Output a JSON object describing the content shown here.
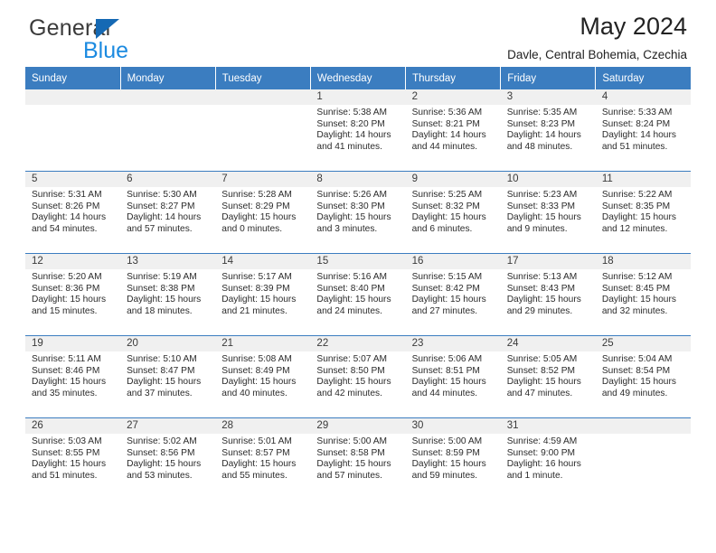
{
  "brand": {
    "word1": "General",
    "word2": "Blue",
    "triangle_color": "#1569b4",
    "blue_color": "#1b8ae0"
  },
  "header": {
    "title": "May 2024",
    "subtitle": "Davle, Central Bohemia, Czechia",
    "header_bg": "#3b7dc0"
  },
  "weekday_headers": [
    "Sunday",
    "Monday",
    "Tuesday",
    "Wednesday",
    "Thursday",
    "Friday",
    "Saturday"
  ],
  "labels": {
    "sunrise": "Sunrise:",
    "sunset": "Sunset:",
    "daylight": "Daylight:"
  },
  "weeks": [
    [
      {
        "day": "",
        "sunrise": "",
        "sunset": "",
        "daylight_line1": "",
        "daylight_line2": ""
      },
      {
        "day": "",
        "sunrise": "",
        "sunset": "",
        "daylight_line1": "",
        "daylight_line2": ""
      },
      {
        "day": "",
        "sunrise": "",
        "sunset": "",
        "daylight_line1": "",
        "daylight_line2": ""
      },
      {
        "day": "1",
        "sunrise": "Sunrise: 5:38 AM",
        "sunset": "Sunset: 8:20 PM",
        "daylight_line1": "Daylight: 14 hours",
        "daylight_line2": "and 41 minutes."
      },
      {
        "day": "2",
        "sunrise": "Sunrise: 5:36 AM",
        "sunset": "Sunset: 8:21 PM",
        "daylight_line1": "Daylight: 14 hours",
        "daylight_line2": "and 44 minutes."
      },
      {
        "day": "3",
        "sunrise": "Sunrise: 5:35 AM",
        "sunset": "Sunset: 8:23 PM",
        "daylight_line1": "Daylight: 14 hours",
        "daylight_line2": "and 48 minutes."
      },
      {
        "day": "4",
        "sunrise": "Sunrise: 5:33 AM",
        "sunset": "Sunset: 8:24 PM",
        "daylight_line1": "Daylight: 14 hours",
        "daylight_line2": "and 51 minutes."
      }
    ],
    [
      {
        "day": "5",
        "sunrise": "Sunrise: 5:31 AM",
        "sunset": "Sunset: 8:26 PM",
        "daylight_line1": "Daylight: 14 hours",
        "daylight_line2": "and 54 minutes."
      },
      {
        "day": "6",
        "sunrise": "Sunrise: 5:30 AM",
        "sunset": "Sunset: 8:27 PM",
        "daylight_line1": "Daylight: 14 hours",
        "daylight_line2": "and 57 minutes."
      },
      {
        "day": "7",
        "sunrise": "Sunrise: 5:28 AM",
        "sunset": "Sunset: 8:29 PM",
        "daylight_line1": "Daylight: 15 hours",
        "daylight_line2": "and 0 minutes."
      },
      {
        "day": "8",
        "sunrise": "Sunrise: 5:26 AM",
        "sunset": "Sunset: 8:30 PM",
        "daylight_line1": "Daylight: 15 hours",
        "daylight_line2": "and 3 minutes."
      },
      {
        "day": "9",
        "sunrise": "Sunrise: 5:25 AM",
        "sunset": "Sunset: 8:32 PM",
        "daylight_line1": "Daylight: 15 hours",
        "daylight_line2": "and 6 minutes."
      },
      {
        "day": "10",
        "sunrise": "Sunrise: 5:23 AM",
        "sunset": "Sunset: 8:33 PM",
        "daylight_line1": "Daylight: 15 hours",
        "daylight_line2": "and 9 minutes."
      },
      {
        "day": "11",
        "sunrise": "Sunrise: 5:22 AM",
        "sunset": "Sunset: 8:35 PM",
        "daylight_line1": "Daylight: 15 hours",
        "daylight_line2": "and 12 minutes."
      }
    ],
    [
      {
        "day": "12",
        "sunrise": "Sunrise: 5:20 AM",
        "sunset": "Sunset: 8:36 PM",
        "daylight_line1": "Daylight: 15 hours",
        "daylight_line2": "and 15 minutes."
      },
      {
        "day": "13",
        "sunrise": "Sunrise: 5:19 AM",
        "sunset": "Sunset: 8:38 PM",
        "daylight_line1": "Daylight: 15 hours",
        "daylight_line2": "and 18 minutes."
      },
      {
        "day": "14",
        "sunrise": "Sunrise: 5:17 AM",
        "sunset": "Sunset: 8:39 PM",
        "daylight_line1": "Daylight: 15 hours",
        "daylight_line2": "and 21 minutes."
      },
      {
        "day": "15",
        "sunrise": "Sunrise: 5:16 AM",
        "sunset": "Sunset: 8:40 PM",
        "daylight_line1": "Daylight: 15 hours",
        "daylight_line2": "and 24 minutes."
      },
      {
        "day": "16",
        "sunrise": "Sunrise: 5:15 AM",
        "sunset": "Sunset: 8:42 PM",
        "daylight_line1": "Daylight: 15 hours",
        "daylight_line2": "and 27 minutes."
      },
      {
        "day": "17",
        "sunrise": "Sunrise: 5:13 AM",
        "sunset": "Sunset: 8:43 PM",
        "daylight_line1": "Daylight: 15 hours",
        "daylight_line2": "and 29 minutes."
      },
      {
        "day": "18",
        "sunrise": "Sunrise: 5:12 AM",
        "sunset": "Sunset: 8:45 PM",
        "daylight_line1": "Daylight: 15 hours",
        "daylight_line2": "and 32 minutes."
      }
    ],
    [
      {
        "day": "19",
        "sunrise": "Sunrise: 5:11 AM",
        "sunset": "Sunset: 8:46 PM",
        "daylight_line1": "Daylight: 15 hours",
        "daylight_line2": "and 35 minutes."
      },
      {
        "day": "20",
        "sunrise": "Sunrise: 5:10 AM",
        "sunset": "Sunset: 8:47 PM",
        "daylight_line1": "Daylight: 15 hours",
        "daylight_line2": "and 37 minutes."
      },
      {
        "day": "21",
        "sunrise": "Sunrise: 5:08 AM",
        "sunset": "Sunset: 8:49 PM",
        "daylight_line1": "Daylight: 15 hours",
        "daylight_line2": "and 40 minutes."
      },
      {
        "day": "22",
        "sunrise": "Sunrise: 5:07 AM",
        "sunset": "Sunset: 8:50 PM",
        "daylight_line1": "Daylight: 15 hours",
        "daylight_line2": "and 42 minutes."
      },
      {
        "day": "23",
        "sunrise": "Sunrise: 5:06 AM",
        "sunset": "Sunset: 8:51 PM",
        "daylight_line1": "Daylight: 15 hours",
        "daylight_line2": "and 44 minutes."
      },
      {
        "day": "24",
        "sunrise": "Sunrise: 5:05 AM",
        "sunset": "Sunset: 8:52 PM",
        "daylight_line1": "Daylight: 15 hours",
        "daylight_line2": "and 47 minutes."
      },
      {
        "day": "25",
        "sunrise": "Sunrise: 5:04 AM",
        "sunset": "Sunset: 8:54 PM",
        "daylight_line1": "Daylight: 15 hours",
        "daylight_line2": "and 49 minutes."
      }
    ],
    [
      {
        "day": "26",
        "sunrise": "Sunrise: 5:03 AM",
        "sunset": "Sunset: 8:55 PM",
        "daylight_line1": "Daylight: 15 hours",
        "daylight_line2": "and 51 minutes."
      },
      {
        "day": "27",
        "sunrise": "Sunrise: 5:02 AM",
        "sunset": "Sunset: 8:56 PM",
        "daylight_line1": "Daylight: 15 hours",
        "daylight_line2": "and 53 minutes."
      },
      {
        "day": "28",
        "sunrise": "Sunrise: 5:01 AM",
        "sunset": "Sunset: 8:57 PM",
        "daylight_line1": "Daylight: 15 hours",
        "daylight_line2": "and 55 minutes."
      },
      {
        "day": "29",
        "sunrise": "Sunrise: 5:00 AM",
        "sunset": "Sunset: 8:58 PM",
        "daylight_line1": "Daylight: 15 hours",
        "daylight_line2": "and 57 minutes."
      },
      {
        "day": "30",
        "sunrise": "Sunrise: 5:00 AM",
        "sunset": "Sunset: 8:59 PM",
        "daylight_line1": "Daylight: 15 hours",
        "daylight_line2": "and 59 minutes."
      },
      {
        "day": "31",
        "sunrise": "Sunrise: 4:59 AM",
        "sunset": "Sunset: 9:00 PM",
        "daylight_line1": "Daylight: 16 hours",
        "daylight_line2": "and 1 minute."
      },
      {
        "day": "",
        "sunrise": "",
        "sunset": "",
        "daylight_line1": "",
        "daylight_line2": ""
      }
    ]
  ]
}
